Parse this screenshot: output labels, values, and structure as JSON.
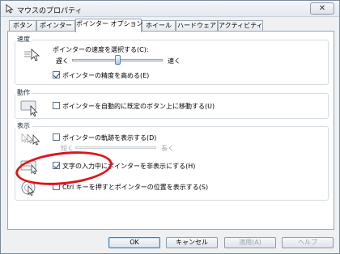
{
  "window": {
    "title": "マウスのプロパティ",
    "close_label": "✕"
  },
  "tabs": [
    {
      "label": "ボタン"
    },
    {
      "label": "ポインター"
    },
    {
      "label": "ポインター オプション"
    },
    {
      "label": "ホイール"
    },
    {
      "label": "ハードウェア"
    },
    {
      "label": "アクティビティ"
    }
  ],
  "active_tab": "ポインター オプション",
  "speed_group": {
    "title": "速度",
    "select_label": "ポインターの速度を選択する(C):",
    "slow_label": "遅く",
    "fast_label": "速く",
    "speed_value": 0.5,
    "precision_label": "ポインターの精度を高める(E)",
    "precision_checked": true
  },
  "motion_group": {
    "title": "動作",
    "snap_label": "ポインターを自動的に既定のボタン上に移動する(U)",
    "snap_checked": false
  },
  "display_group": {
    "title": "表示",
    "trails_label": "ポインターの軌跡を表示する(D)",
    "trails_checked": false,
    "short_label": "短く",
    "long_label": "長く",
    "hide_label": "文字の入力中にポインターを非表示にする(H)",
    "hide_checked": true,
    "ctrl_label": "Ctrl キーを押すとポインターの位置を表示する(S)",
    "ctrl_checked": false
  },
  "buttons": {
    "ok": "OK",
    "cancel": "キャンセル",
    "apply": "適用(A)",
    "help": "ヘルプ"
  },
  "colors": {
    "annotation": "#e0141b",
    "accent": "#3c7fb1"
  }
}
